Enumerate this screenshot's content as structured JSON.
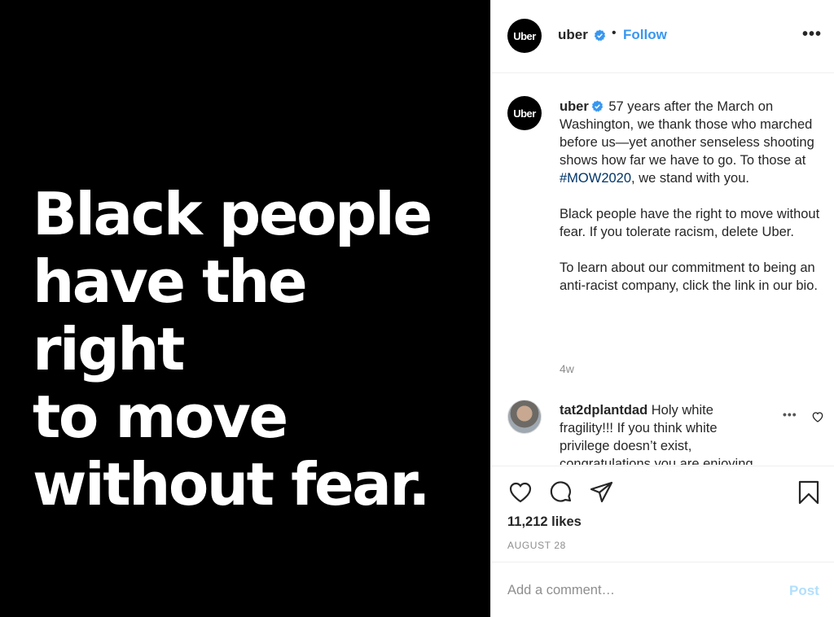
{
  "media": {
    "headline": "Black people\nhave the right\nto move\nwithout fear."
  },
  "header": {
    "avatar_text": "Uber",
    "username": "uber",
    "separator": "•",
    "follow_label": "Follow",
    "more_label": "•••"
  },
  "caption": {
    "avatar_text": "Uber",
    "username": "uber",
    "text_before_hashtag": "57 years after the March on Washington, we thank those who marched before us—yet another senseless shooting shows how far we have to go. To those at ",
    "hashtag": "#MOW2020",
    "text_after_hashtag": ", we stand with you.",
    "paragraph_2": "Black people have the right to move without fear. If you tolerate racism, delete Uber.",
    "paragraph_3": "To learn about our commitment to being an anti-racist company, click the link in our bio.",
    "time": "4w"
  },
  "comment": {
    "username": "tat2dplantdad",
    "text": "Holy white fragility!!! If you think white privilege doesn’t exist, congratulations you are enjoying",
    "more_label": "•••"
  },
  "actions": {
    "likes": "11,212 likes",
    "date": "AUGUST 28"
  },
  "add_comment": {
    "placeholder": "Add a comment…",
    "post_label": "Post"
  },
  "colors": {
    "accent": "#3897f0",
    "hashtag": "#003569",
    "post_disabled": "#b2dffc",
    "media_bg": "#000000"
  },
  "icons": [
    "verified-badge-icon",
    "more-options-icon",
    "heart-icon",
    "comment-icon",
    "share-icon",
    "bookmark-icon"
  ]
}
